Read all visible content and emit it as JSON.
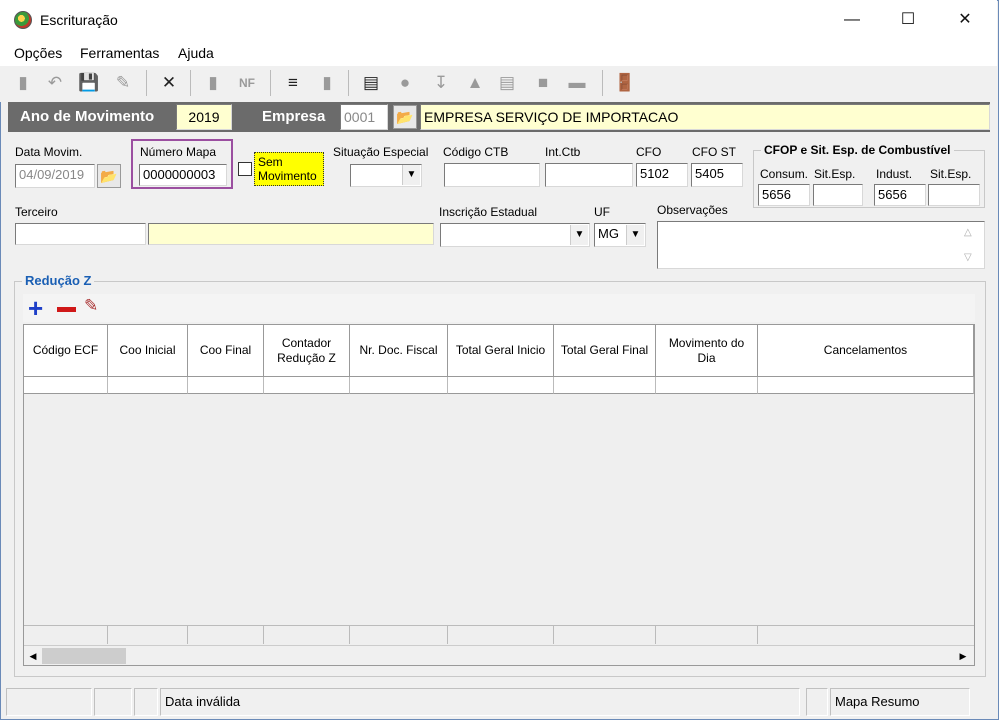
{
  "window": {
    "title": "Escrituração"
  },
  "menu": [
    "Opções",
    "Ferramentas",
    "Ajuda"
  ],
  "header": {
    "ano_label": "Ano de Movimento",
    "ano_value": "2019",
    "empresa_label": "Empresa",
    "empresa_code": "0001",
    "empresa_name": "EMPRESA SERVIÇO DE IMPORTACAO"
  },
  "form": {
    "data_movim_label": "Data Movim.",
    "data_movim_value": "04/09/2019",
    "numero_mapa_label": "Número Mapa",
    "numero_mapa_value": "0000000003",
    "sem_movimento_label_1": "Sem",
    "sem_movimento_label_2": "Movimento",
    "situacao_label": "Situação Especial",
    "situacao_value": "",
    "codigo_ctb_label": "Código CTB",
    "codigo_ctb_value": "",
    "intctb_label": "Int.Ctb",
    "intctb_value": "",
    "cfo_label": "CFO",
    "cfo_value": "5102",
    "cfost_label": "CFO ST",
    "cfost_value": "5405",
    "combustivel_title": "CFOP e Sit. Esp. de Combustível",
    "consum_label": "Consum.",
    "consum_value": "5656",
    "sitesp1_label": "Sit.Esp.",
    "sitesp1_value": "",
    "indust_label": "Indust.",
    "indust_value": "5656",
    "sitesp2_label": "Sit.Esp.",
    "sitesp2_value": "",
    "terceiro_label": "Terceiro",
    "terceiro_code": "",
    "terceiro_name": "",
    "ie_label": "Inscrição Estadual",
    "ie_value": "",
    "uf_label": "UF",
    "uf_value": "MG",
    "obs_label": "Observações",
    "obs_value": ""
  },
  "reducao": {
    "title": "Redução Z",
    "columns": [
      "Código ECF",
      "Coo Inicial",
      "Coo Final",
      "Contador Redução Z",
      "Nr. Doc. Fiscal",
      "Total Geral Inicio",
      "Total Geral Final",
      "Movimento do Dia",
      "Cancelamentos"
    ]
  },
  "status": {
    "message": "Data inválida",
    "right": "Mapa Resumo"
  }
}
